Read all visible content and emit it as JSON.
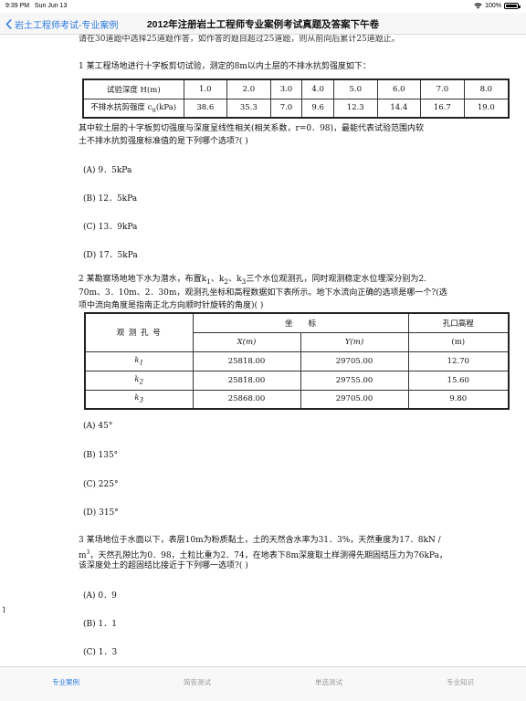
{
  "status": {
    "time": "9:39 PM",
    "date": "Sun Jun 13",
    "battery": "100%"
  },
  "nav": {
    "back_label": "岩土工程师考试-专业案例",
    "title": "2012年注册岩土工程师专业案例考试真题及答案下午卷"
  },
  "content": {
    "cut_line": "请在30道题中选择25道题作答，如作答的题目超过25道题，则从前向后累计25道题止。",
    "q1": {
      "text": "1 某工程场地进行十字板剪切试验，测定的8m以内土层的不排水抗剪强度如下：",
      "table": {
        "row_label_1": "试验深度 H(m)",
        "row_label_2": "不排水抗剪强度 c",
        "row_label_2_sub": "u",
        "row_label_2_unit": "(kPa)",
        "depths": [
          "1.0",
          "2.0",
          "3.0",
          "4.0",
          "5.0",
          "6.0",
          "7.0",
          "8.0"
        ],
        "strengths": [
          "38.6",
          "35.3",
          "7.0",
          "9.6",
          "12.3",
          "14.4",
          "16.7",
          "19.0"
        ]
      },
      "text2_line1": "其中软土层的十字板剪切强度与深度呈线性相关(相关系数，r=0．98)，最能代表试验范围内软",
      "text2_line2": "土不排水抗剪强度标准值的是下列哪个选项?( )",
      "options": [
        "(A) 9．5kPa",
        "(B) 12．5kPa",
        "(C) 13．9kPa",
        "(D) 17．5kPa"
      ]
    },
    "q2": {
      "line1_a": "2 某勘察场地地下水为潜水，布置k",
      "sub1": "1",
      "line1_b": "、k",
      "sub2": "2",
      "line1_c": "、k",
      "sub3": "3",
      "line1_d": "三个水位观测孔，同时观测稳定水位埋深分别为2.",
      "line2": "70m、3．10m、2．30m，观测孔坐标和高程数据如下表所示。地下水流向正确的选项是哪一个?(选",
      "line3": "项中流向角度是指南正北方向顺时针旋转的角度)( )",
      "table": {
        "hole_header": "观 测 孔 号",
        "coord_header": "坐　　标",
        "elev_header": "孔口高程",
        "x_header": "X(m)",
        "y_header": "Y(m)",
        "elev_unit": "(m)",
        "rows": [
          {
            "hole": "k",
            "sub": "1",
            "x": "25818.00",
            "y": "29705.00",
            "elev": "12.70"
          },
          {
            "hole": "k",
            "sub": "2",
            "x": "25818.00",
            "y": "29755.00",
            "elev": "15.60"
          },
          {
            "hole": "k",
            "sub": "3",
            "x": "25868.00",
            "y": "29705.00",
            "elev": "9.80"
          }
        ]
      },
      "options": [
        "(A) 45°",
        "(B) 135°",
        "(C) 225°",
        "(D) 315°"
      ]
    },
    "q3": {
      "line1": "3 某场地位于水面以下，表层10m为粉质黏土，土的天然含水率为31．3%，天然重度为17．8kN /",
      "line2_a": "m",
      "line2_sup": "3",
      "line2_b": "，天然孔隙比为0．98，土粒比重为2．74，在地表下8m深度取土样测得先期固结压力为76kPa，",
      "line3": "该深度处土的超固结比接近于下列哪一选项?( )",
      "options": [
        "(A) 0．9",
        "(B) 1．1",
        "(C) 1．3"
      ]
    },
    "side_mark": "1"
  },
  "tabs": [
    {
      "label": "专业案例",
      "active": true
    },
    {
      "label": "简答测试",
      "active": false
    },
    {
      "label": "单选测试",
      "active": false
    },
    {
      "label": "专业知识",
      "active": false
    }
  ],
  "colors": {
    "accent": "#2c7ae0",
    "inactive": "#999999"
  }
}
